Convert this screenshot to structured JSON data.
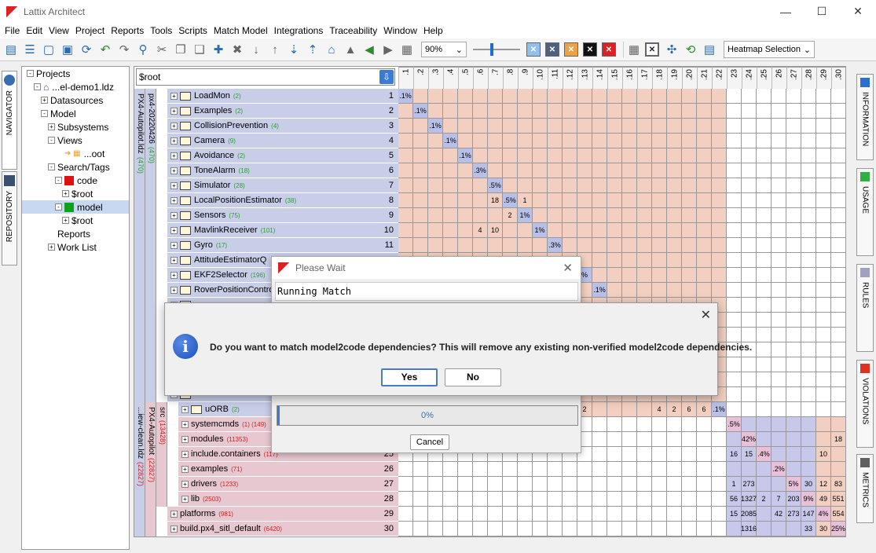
{
  "window": {
    "title": "Lattix Architect",
    "minimize": "—",
    "maximize": "☐",
    "close": "✕"
  },
  "menu": [
    "File",
    "Edit",
    "View",
    "Project",
    "Reports",
    "Tools",
    "Scripts",
    "Match Model",
    "Integrations",
    "Traceability",
    "Window",
    "Help"
  ],
  "toolbar": {
    "zoom": "90%",
    "heatmap": "Heatmap Selection",
    "icons": [
      "new-icon",
      "layers-icon",
      "open-icon",
      "save-icon",
      "refresh-icon",
      "undo-icon",
      "redo-icon",
      "search-icon",
      "cut-icon",
      "copy-icon",
      "paste-icon",
      "add-icon",
      "delete-icon",
      "move-down-icon",
      "move-up-icon",
      "expand-icon",
      "collapse-icon",
      "home-icon",
      "warning-icon",
      "back-icon",
      "forward-icon",
      "grid-icon"
    ]
  },
  "left_tabs": {
    "navigator": "NAVIGATOR",
    "repository": "REPOSITORY"
  },
  "right_tabs": {
    "information": "INFORMATION",
    "usage": "USAGE",
    "rules": "RULES",
    "violations": "VIOLATIONS",
    "metrics": "METRICS"
  },
  "navigator": {
    "items": [
      {
        "label": "Projects",
        "indent": 0,
        "toggle": "-"
      },
      {
        "label": "...el-demo1.ldz",
        "indent": 1,
        "toggle": "-",
        "icon": "home"
      },
      {
        "label": "Datasources",
        "indent": 2,
        "toggle": "+"
      },
      {
        "label": "Model",
        "indent": 2,
        "toggle": "-"
      },
      {
        "label": "Subsystems",
        "indent": 3,
        "toggle": "+"
      },
      {
        "label": "Views",
        "indent": 3,
        "toggle": "-"
      },
      {
        "label": "...oot",
        "indent": 4,
        "toggle": "",
        "icon": "view"
      },
      {
        "label": "Search/Tags",
        "indent": 3,
        "toggle": "-"
      },
      {
        "label": "code",
        "indent": 4,
        "toggle": "-",
        "swatch": "#e01010"
      },
      {
        "label": "$root",
        "indent": 5,
        "toggle": "+"
      },
      {
        "label": "model",
        "indent": 4,
        "toggle": "-",
        "swatch": "#10a020",
        "selected": true
      },
      {
        "label": "$root",
        "indent": 5,
        "toggle": "+"
      },
      {
        "label": "Reports",
        "indent": 3,
        "toggle": ""
      },
      {
        "label": "Work List",
        "indent": 3,
        "toggle": "+"
      }
    ]
  },
  "matrix": {
    "search": "$root",
    "columns": [
      ".1",
      ".2",
      ".3",
      ".4",
      ".5",
      ".6",
      ".7",
      ".8",
      ".9",
      ".10",
      ".11",
      ".12",
      ".13",
      ".14",
      ".15",
      ".16",
      ".17",
      ".18",
      ".19",
      ".20",
      ".21",
      ".22",
      "23",
      ".24",
      ".25",
      "26",
      ".27",
      ".28",
      ".29",
      ".30"
    ],
    "stripes": [
      {
        "label": "PX4-Autopilot.ldz",
        "count": "(470)"
      },
      {
        "label": "px4-20220426",
        "count": "(470)"
      },
      {
        "label": "...iew-clean.ldz",
        "count": "(22827)"
      },
      {
        "label": "PX4-Autopilot",
        "count": "(22827)"
      },
      {
        "label": "src",
        "count": "(13428)"
      }
    ],
    "rows": [
      {
        "n": "1",
        "name": "LoadMon",
        "cnt": "(2)",
        "red": false
      },
      {
        "n": "2",
        "name": "Examples",
        "cnt": "(2)",
        "red": false
      },
      {
        "n": "3",
        "name": "CollisionPrevention",
        "cnt": "(4)",
        "red": false
      },
      {
        "n": "4",
        "name": "Camera",
        "cnt": "(9)",
        "red": false
      },
      {
        "n": "5",
        "name": "Avoidance",
        "cnt": "(2)",
        "red": false
      },
      {
        "n": "6",
        "name": "ToneAlarm",
        "cnt": "(18)",
        "red": false
      },
      {
        "n": "7",
        "name": "Simulator",
        "cnt": "(28)",
        "red": false
      },
      {
        "n": "8",
        "name": "LocalPositionEstimator",
        "cnt": "(38)",
        "red": false
      },
      {
        "n": "9",
        "name": "Sensors",
        "cnt": "(75)",
        "red": false
      },
      {
        "n": "10",
        "name": "MavlinkReceiver",
        "cnt": "(101)",
        "red": false
      },
      {
        "n": "11",
        "name": "Gyro",
        "cnt": "(17)",
        "red": false
      },
      {
        "n": "",
        "name": "AttitudeEstimatorQ",
        "cnt": "",
        "red": false
      },
      {
        "n": "",
        "name": "EKF2Selector",
        "cnt": "(196)",
        "red": false
      },
      {
        "n": "",
        "name": "RoverPositionContro",
        "cnt": "",
        "red": false
      },
      {
        "n": "",
        "name": "",
        "cnt": "",
        "red": false
      },
      {
        "n": "",
        "name": "",
        "cnt": "",
        "red": false
      },
      {
        "n": "",
        "name": "",
        "cnt": "",
        "red": false
      },
      {
        "n": "",
        "name": "",
        "cnt": "",
        "red": false
      },
      {
        "n": "",
        "name": "",
        "cnt": "",
        "red": false
      },
      {
        "n": "",
        "name": "",
        "cnt": "",
        "red": false
      },
      {
        "n": "",
        "name": "",
        "cnt": "",
        "red": false
      },
      {
        "n": "",
        "name": "uORB",
        "cnt": "(2)",
        "red": false
      },
      {
        "n": "",
        "name": "systemcmds",
        "cnt": "(1) (149)",
        "red": true
      },
      {
        "n": "",
        "name": "modules",
        "cnt": "(11353)",
        "red": true
      },
      {
        "n": "25",
        "name": "include.containers",
        "cnt": "(117)",
        "red": true
      },
      {
        "n": "26",
        "name": "examples",
        "cnt": "(71)",
        "red": true
      },
      {
        "n": "27",
        "name": "drivers",
        "cnt": "(1233)",
        "red": true
      },
      {
        "n": "28",
        "name": "lib",
        "cnt": "(2503)",
        "red": true
      },
      {
        "n": "29",
        "name": "platforms",
        "cnt": "(981)",
        "red": true
      },
      {
        "n": "30",
        "name": "build.px4_sitl_default",
        "cnt": "(6420)",
        "red": true
      }
    ],
    "cells": [
      {
        "r": 0,
        "c": 0,
        "v": ".1%",
        "t": "diag"
      },
      {
        "r": 1,
        "c": 1,
        "v": ".1%",
        "t": "diag"
      },
      {
        "r": 2,
        "c": 2,
        "v": ".1%",
        "t": "diag"
      },
      {
        "r": 3,
        "c": 3,
        "v": ".1%",
        "t": "diag"
      },
      {
        "r": 4,
        "c": 4,
        "v": ".1%",
        "t": "diag"
      },
      {
        "r": 5,
        "c": 5,
        "v": ".3%",
        "t": "diag"
      },
      {
        "r": 6,
        "c": 6,
        "v": ".5%",
        "t": "diag"
      },
      {
        "r": 7,
        "c": 6,
        "v": "18",
        "t": ""
      },
      {
        "r": 7,
        "c": 7,
        "v": ".5%",
        "t": "diag"
      },
      {
        "r": 7,
        "c": 8,
        "v": "1",
        "t": ""
      },
      {
        "r": 8,
        "c": 7,
        "v": "2",
        "t": ""
      },
      {
        "r": 8,
        "c": 8,
        "v": "1%",
        "t": "diag"
      },
      {
        "r": 9,
        "c": 5,
        "v": "4",
        "t": ""
      },
      {
        "r": 9,
        "c": 6,
        "v": "10",
        "t": ""
      },
      {
        "r": 9,
        "c": 9,
        "v": "1%",
        "t": "diag"
      },
      {
        "r": 10,
        "c": 10,
        "v": ".3%",
        "t": "diag"
      },
      {
        "r": 12,
        "c": 12,
        "v": "%",
        "t": "diag"
      },
      {
        "r": 13,
        "c": 13,
        "v": ".1%",
        "t": "diag"
      },
      {
        "r": 21,
        "c": 12,
        "v": "2",
        "t": ""
      },
      {
        "r": 21,
        "c": 17,
        "v": "4",
        "t": ""
      },
      {
        "r": 21,
        "c": 18,
        "v": "2",
        "t": ""
      },
      {
        "r": 21,
        "c": 19,
        "v": "6",
        "t": ""
      },
      {
        "r": 21,
        "c": 20,
        "v": "6",
        "t": ""
      },
      {
        "r": 21,
        "c": 21,
        "v": ".1%",
        "t": "diag"
      },
      {
        "r": 22,
        "c": 22,
        "v": ".5%",
        "t": "diag2"
      },
      {
        "r": 23,
        "c": 23,
        "v": "42%",
        "t": "diag2"
      },
      {
        "r": 23,
        "c": 29,
        "v": "18",
        "t": ""
      },
      {
        "r": 24,
        "c": 22,
        "v": "16",
        "t": ""
      },
      {
        "r": 24,
        "c": 23,
        "v": "15",
        "t": ""
      },
      {
        "r": 24,
        "c": 24,
        "v": ".4%",
        "t": "diag2"
      },
      {
        "r": 24,
        "c": 28,
        "v": "10",
        "t": ""
      },
      {
        "r": 25,
        "c": 25,
        "v": ".2%",
        "t": "diag2"
      },
      {
        "r": 26,
        "c": 22,
        "v": "1",
        "t": ""
      },
      {
        "r": 26,
        "c": 23,
        "v": "273",
        "t": ""
      },
      {
        "r": 26,
        "c": 26,
        "v": "5%",
        "t": "diag2"
      },
      {
        "r": 26,
        "c": 27,
        "v": "30",
        "t": ""
      },
      {
        "r": 26,
        "c": 28,
        "v": "12",
        "t": ""
      },
      {
        "r": 26,
        "c": 29,
        "v": "83",
        "t": ""
      },
      {
        "r": 27,
        "c": 22,
        "v": "56",
        "t": ""
      },
      {
        "r": 27,
        "c": 23,
        "v": "1327",
        "t": ""
      },
      {
        "r": 27,
        "c": 24,
        "v": "2",
        "t": ""
      },
      {
        "r": 27,
        "c": 25,
        "v": "7",
        "t": ""
      },
      {
        "r": 27,
        "c": 26,
        "v": "203",
        "t": ""
      },
      {
        "r": 27,
        "c": 27,
        "v": "9%",
        "t": "diag2"
      },
      {
        "r": 27,
        "c": 28,
        "v": "49",
        "t": ""
      },
      {
        "r": 27,
        "c": 29,
        "v": "551",
        "t": ""
      },
      {
        "r": 28,
        "c": 22,
        "v": "15",
        "t": ""
      },
      {
        "r": 28,
        "c": 23,
        "v": "2085",
        "t": ""
      },
      {
        "r": 28,
        "c": 25,
        "v": "42",
        "t": ""
      },
      {
        "r": 28,
        "c": 26,
        "v": "273",
        "t": ""
      },
      {
        "r": 28,
        "c": 27,
        "v": "147",
        "t": ""
      },
      {
        "r": 28,
        "c": 28,
        "v": "4%",
        "t": "diag2"
      },
      {
        "r": 28,
        "c": 29,
        "v": "554",
        "t": ""
      },
      {
        "r": 29,
        "c": 23,
        "v": "1316",
        "t": ""
      },
      {
        "r": 29,
        "c": 27,
        "v": "33",
        "t": ""
      },
      {
        "r": 29,
        "c": 28,
        "v": "30",
        "t": ""
      },
      {
        "r": 29,
        "c": 29,
        "v": "25%",
        "t": "diag2"
      }
    ],
    "colors": {
      "block1": "#f2cfc0",
      "block2": "#c8c8ea",
      "diag": "#b8c0e8",
      "rowblue": "#c8cde8",
      "rowpink": "#e8c8d0"
    }
  },
  "wait_dialog": {
    "title": "Please Wait",
    "status": "Running Match",
    "progress": "0%",
    "cancel": "Cancel"
  },
  "confirm_dialog": {
    "message": "Do you want to match model2code dependencies? This will remove any existing non-verified model2code dependencies.",
    "yes": "Yes",
    "no": "No"
  }
}
